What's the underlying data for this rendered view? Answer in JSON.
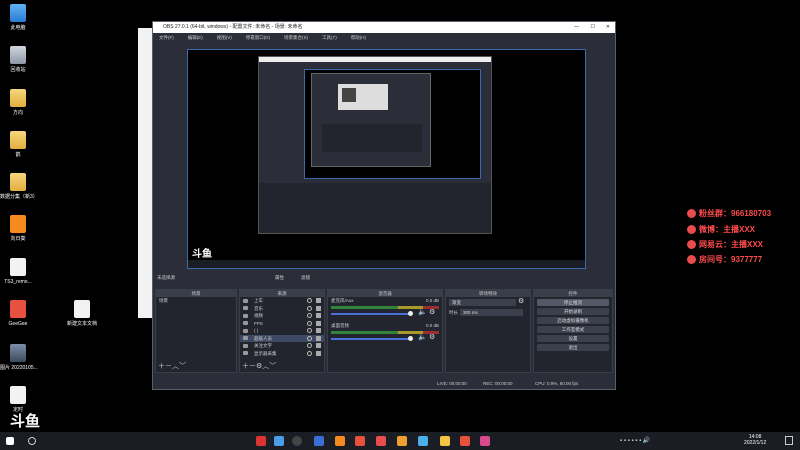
{
  "desktop": {
    "icons": [
      {
        "label": "此电脑",
        "glyph": "g-pc"
      },
      {
        "label": "回收站",
        "glyph": "g-bin"
      },
      {
        "label": "方向",
        "glyph": "g-folder"
      },
      {
        "label": "鹊",
        "glyph": "g-folder"
      },
      {
        "label": "数据分集（新3）",
        "glyph": "g-folder"
      },
      {
        "label": "向日葵",
        "glyph": "g-orange"
      },
      {
        "label": "TS3_remo...",
        "glyph": "g-file"
      },
      {
        "label": "GeeGee",
        "glyph": "g-red"
      },
      {
        "label": "新建文本文档",
        "glyph": "g-file"
      },
      {
        "label": "图片 20220105...",
        "glyph": "g-img"
      },
      {
        "label": "定时",
        "glyph": "g-file"
      }
    ],
    "logo_text": "斗鱼"
  },
  "obs": {
    "title": "OBS 27.0.1 (64-bit, windows) - 配置文件: 未命名 - 场景: 未命名",
    "menu": [
      "文件(F)",
      "编辑(E)",
      "视图(V)",
      "停靠窗口(D)",
      "场景集合(S)",
      "工具(T)",
      "帮助(H)"
    ],
    "source_bar_label": "未选择源",
    "source_bar_props": "属性",
    "source_bar_filters": "滤镜",
    "panels": {
      "scenes": {
        "title": "场景",
        "items": [
          "场景"
        ]
      },
      "sources": {
        "title": "来源",
        "items": [
          "上车",
          "音乐",
          "视频",
          "FPS",
          "( )",
          "超级人员",
          "关注文字",
          "显示器采集"
        ],
        "selected_index": 5
      },
      "mixer": {
        "title": "混音器",
        "channels": [
          {
            "name": "麦克风/Aux",
            "db": "0.0 dB"
          },
          {
            "name": "桌面音频",
            "db": "0.0 dB"
          }
        ]
      },
      "transitions": {
        "title": "转场特效",
        "type": "渐变",
        "duration_label": "时长",
        "duration": "300 ms"
      },
      "controls": {
        "title": "控件",
        "buttons": [
          "停止推流",
          "开始录制",
          "启动虚拟摄像机",
          "工作室模式",
          "设置",
          "退出"
        ]
      }
    },
    "status": {
      "live": "LIVE: 00:00:00",
      "rec": "REC: 00:00:00",
      "cpu": "CPU: 0.9%, 60.00 fps"
    }
  },
  "overlay": {
    "lines": [
      {
        "icon": "fan-group-icon",
        "text": "粉丝群：966180703"
      },
      {
        "icon": "weibo-icon",
        "text": "微博：主播XXX"
      },
      {
        "icon": "netease-icon",
        "text": "网易云：主播XXX"
      },
      {
        "icon": "room-icon",
        "text": "房间号：9377777"
      }
    ]
  },
  "taskbar": {
    "time": "14:08",
    "date": "2022/1/12"
  },
  "colors": {
    "accent": "#3c6aa8",
    "overlay_text": "#ff4d4d"
  }
}
